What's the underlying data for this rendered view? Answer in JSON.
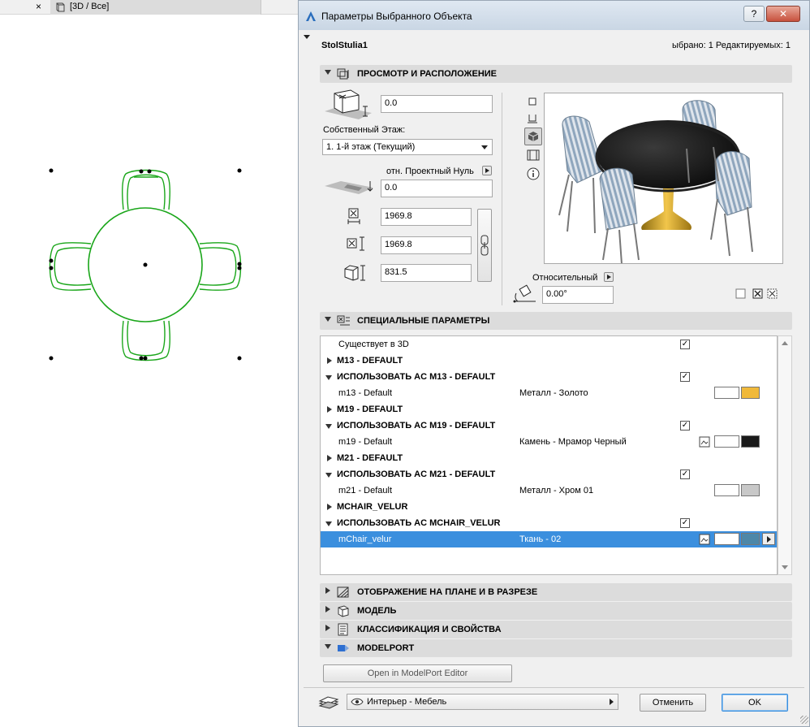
{
  "background": {
    "tab_close": "×",
    "tab_label": "[3D / Все]"
  },
  "dialog": {
    "title": "Параметры Выбранного Объекта",
    "help": "?",
    "close": "✕",
    "object_name": "StolStulia1",
    "selection_info": "ыбрано: 1 Редактируемых: 1",
    "preview_section": {
      "title": "ПРОСМОТР И РАСПОЛОЖЕНИЕ",
      "elevation_value": "0.0",
      "home_story_label": "Собственный Этаж:",
      "home_story_value": "1. 1-й этаж (Текущий)",
      "reference_label": "отн. Проектный Нуль",
      "reference_value": "0.0",
      "width": "1969.8",
      "depth": "1969.8",
      "height": "831.5",
      "rotation_label": "Относительный",
      "rotation_value": "0.00°"
    },
    "params_section": {
      "title": "СПЕЦИАЛЬНЫЕ ПАРАМЕТРЫ",
      "rows": [
        {
          "label": "Существует в 3D",
          "value": "",
          "check": "✓"
        },
        {
          "label": "M13 - DEFAULT",
          "value": "",
          "check": ""
        },
        {
          "label": "ИСПОЛЬЗОВАТЬ AC M13 - DEFAULT",
          "value": "",
          "check": "✓"
        },
        {
          "label": "m13 - Default",
          "value": "Металл - Золото",
          "check": ""
        },
        {
          "label": "M19 - DEFAULT",
          "value": "",
          "check": ""
        },
        {
          "label": "ИСПОЛЬЗОВАТЬ AC M19 - DEFAULT",
          "value": "",
          "check": "✓"
        },
        {
          "label": "m19 - Default",
          "value": "Камень - Мрамор Черный",
          "check": ""
        },
        {
          "label": "M21 - DEFAULT",
          "value": "",
          "check": ""
        },
        {
          "label": "ИСПОЛЬЗОВАТЬ AC M21 - DEFAULT",
          "value": "",
          "check": "✓"
        },
        {
          "label": "m21 - Default",
          "value": "Металл - Хром 01",
          "check": ""
        },
        {
          "label": "MCHAIR_VELUR",
          "value": "",
          "check": ""
        },
        {
          "label": "ИСПОЛЬЗОВАТЬ AC MCHAIR_VELUR",
          "value": "",
          "check": "✓"
        },
        {
          "label": "mChair_velur",
          "value": "Ткань - 02",
          "check": ""
        }
      ],
      "swatch_colors": {
        "gold": "#f0b93a",
        "black": "#1a1a1a",
        "chrome": "#c8c8c8",
        "fabric": "#4d87a8"
      }
    },
    "collapsed_sections": [
      {
        "title": "ОТОБРАЖЕНИЕ НА ПЛАНЕ И В РАЗРЕЗЕ"
      },
      {
        "title": "МОДЕЛЬ"
      },
      {
        "title": "КЛАССИФИКАЦИЯ И СВОЙСТВА"
      },
      {
        "title": "MODELPORT"
      }
    ],
    "modelport_button": "Open in ModelPort Editor",
    "layer_value": "Интерьер - Мебель",
    "cancel": "Отменить",
    "ok": "OK"
  }
}
